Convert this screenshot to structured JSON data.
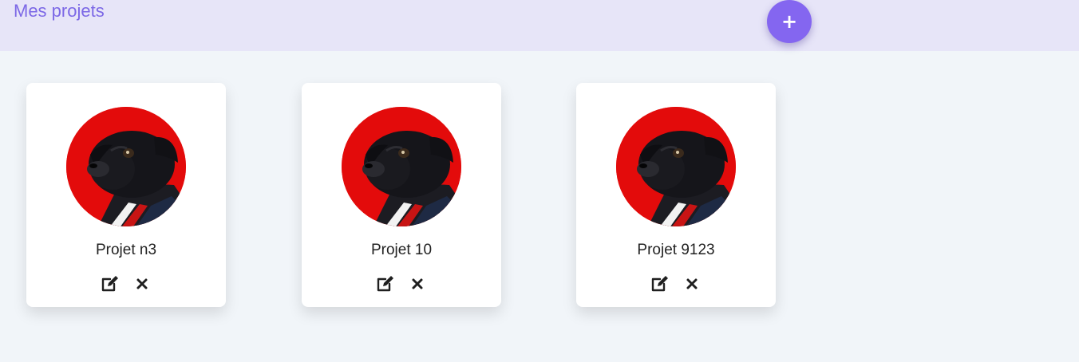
{
  "header": {
    "title": "Mes projets",
    "add_label": "+"
  },
  "colors": {
    "header_bg": "#e7e5f8",
    "accent": "#8466f0",
    "title": "#7c68e6",
    "avatar_bg": "#e00a0a"
  },
  "projects": [
    {
      "name": "Projet n3",
      "edit_icon": "edit-icon",
      "delete_icon": "close-icon"
    },
    {
      "name": "Projet 10",
      "edit_icon": "edit-icon",
      "delete_icon": "close-icon"
    },
    {
      "name": "Projet 9123",
      "edit_icon": "edit-icon",
      "delete_icon": "close-icon"
    }
  ]
}
